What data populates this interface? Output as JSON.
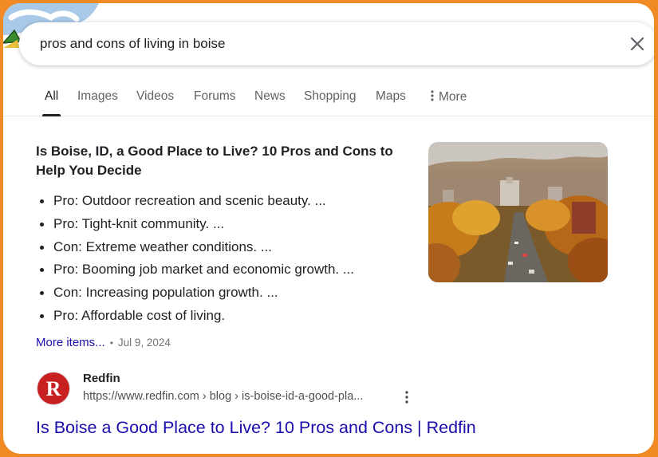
{
  "search": {
    "query": "pros and cons of living in boise"
  },
  "tabs": [
    {
      "label": "All",
      "active": true
    },
    {
      "label": "Images"
    },
    {
      "label": "Videos"
    },
    {
      "label": "Forums"
    },
    {
      "label": "News"
    },
    {
      "label": "Shopping"
    },
    {
      "label": "Maps"
    },
    {
      "label": "More",
      "icon": "more-vert-icon"
    }
  ],
  "snippet": {
    "title": "Is Boise, ID, a Good Place to Live? 10 Pros and Cons to Help You Decide",
    "bullets": [
      "Pro: Outdoor recreation and scenic beauty. ...",
      "Pro: Tight-knit community. ...",
      "Con: Extreme weather conditions. ...",
      "Pro: Booming job market and economic growth. ...",
      "Con: Increasing population growth. ...",
      "Pro: Affordable cost of living."
    ],
    "more_items": "More items...",
    "separator": "•",
    "date": "Jul 9, 2024"
  },
  "result": {
    "favicon_letter": "R",
    "site_name": "Redfin",
    "url": "https://www.redfin.com › blog › is-boise-id-a-good-pla...",
    "title": "Is Boise a Good Place to Live? 10 Pros and Cons | Redfin"
  },
  "colors": {
    "frame": "#f08a24",
    "link": "#1a0dab",
    "redfin_red": "#c82021"
  }
}
